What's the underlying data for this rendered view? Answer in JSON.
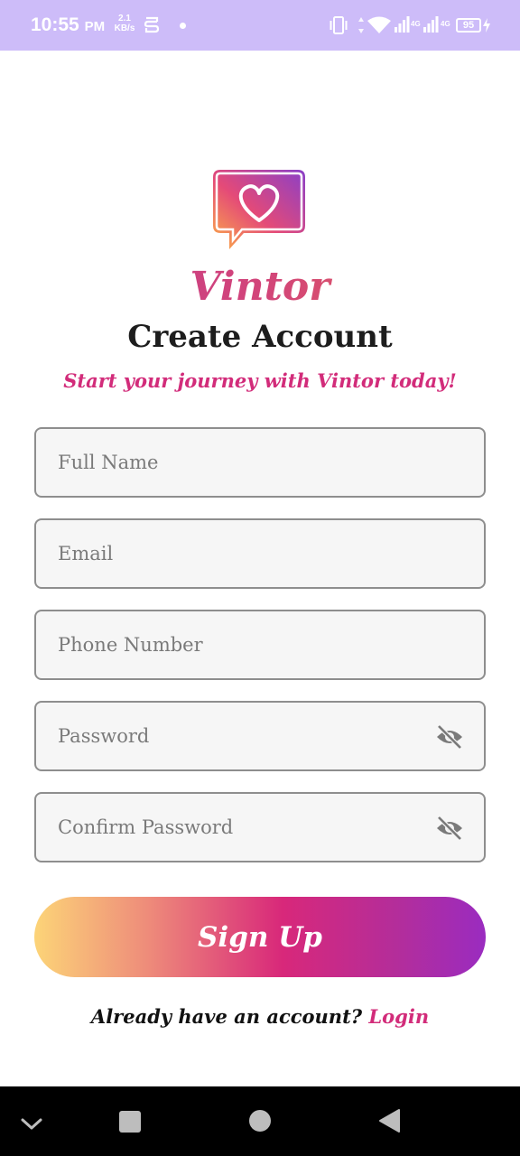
{
  "status_bar": {
    "time": "10:55",
    "ampm": "PM",
    "speed_value": "2.1",
    "speed_unit": "KB/s",
    "battery": "95",
    "network_1": "4G",
    "network_2": "4G",
    "icons": [
      "s-app-icon",
      "notification-dot-icon",
      "vibrate-icon",
      "wifi-icon",
      "signal-icon",
      "signal-icon",
      "battery-icon",
      "charging-icon"
    ]
  },
  "app": {
    "brand": "Vintor",
    "title": "Create Account",
    "subtitle": "Start your journey with Vintor today!",
    "logo_icon": "heart-chat-bubble-icon",
    "colors": {
      "accent_pink": "#d22c7a",
      "gradient_start": "#fcd478",
      "gradient_mid": "#d8287a",
      "gradient_end": "#9a2cc0"
    }
  },
  "form": {
    "full_name": {
      "placeholder": "Full Name",
      "value": ""
    },
    "email": {
      "placeholder": "Email",
      "value": ""
    },
    "phone": {
      "placeholder": "Phone Number",
      "value": ""
    },
    "password": {
      "placeholder": "Password",
      "value": "",
      "toggle_icon": "eye-off-icon"
    },
    "confirm_password": {
      "placeholder": "Confirm Password",
      "value": "",
      "toggle_icon": "eye-off-icon"
    },
    "submit_label": "Sign Up",
    "login_prompt": "Already have an account?",
    "login_link": "Login"
  },
  "nav_bar": {
    "icons": [
      "chevron-down-icon",
      "recents-square-icon",
      "home-circle-icon",
      "back-triangle-icon"
    ]
  }
}
